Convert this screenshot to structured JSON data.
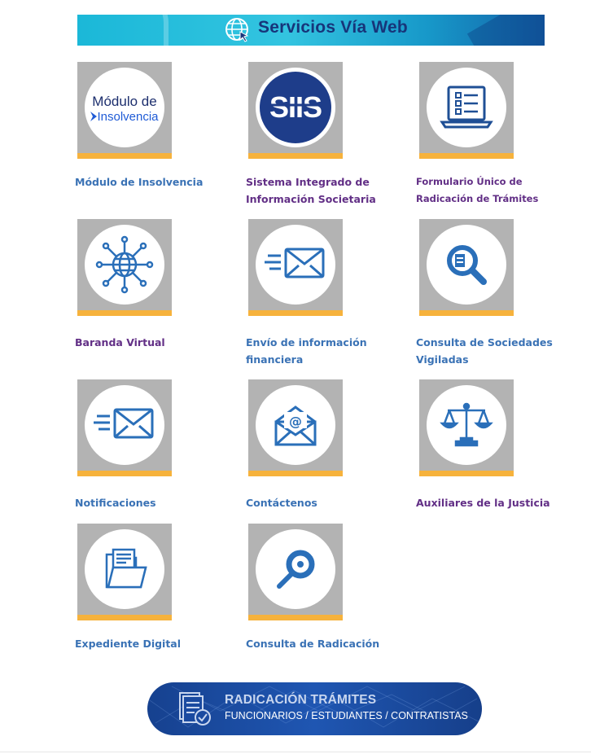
{
  "banner": {
    "title": "Servicios Vía Web",
    "icon": "globe-cursor-icon"
  },
  "services": [
    {
      "label": "Módulo de Insolvencia",
      "icon": "modulo-insolvencia-logo",
      "color": "#3a72b5",
      "logo_line1": "Módulo de",
      "logo_line2": "Insolvencia"
    },
    {
      "label": "Sistema Integrado de Información Societaria",
      "icon": "siis-logo",
      "color": "#622f86",
      "logo_text": "SIIS"
    },
    {
      "label": "Formulario Único de Radicación de Trámites",
      "icon": "laptop-checklist-icon",
      "color": "#622f86"
    },
    {
      "label": "Baranda Virtual",
      "icon": "network-globe-icon",
      "color": "#622f86"
    },
    {
      "label": "Envío de información financiera",
      "icon": "fast-mail-icon",
      "color": "#3a72b5"
    },
    {
      "label": "Consulta de Sociedades Vigiladas",
      "icon": "search-document-icon",
      "color": "#3a72b5"
    },
    {
      "label": "Notificaciones",
      "icon": "fast-mail-icon",
      "color": "#3a72b5"
    },
    {
      "label": "Contáctenos",
      "icon": "email-at-icon",
      "color": "#3a72b5"
    },
    {
      "label": "Auxiliares de la Justicia",
      "icon": "scales-justice-icon",
      "color": "#622f86"
    },
    {
      "label": "Expediente Digital",
      "icon": "folder-documents-icon",
      "color": "#3a72b5"
    },
    {
      "label": "Consulta de Radicación",
      "icon": "magnifier-icon",
      "color": "#3a72b5"
    }
  ],
  "footer_banner": {
    "title": "RADICACIÓN TRÁMITES",
    "subtitle": "FUNCIONARIOS / ESTUDIANTES / CONTRATISTAS",
    "icon": "document-check-icon"
  },
  "colors": {
    "tile_gray": "#b3b3b3",
    "tile_bar": "#f6b23c",
    "icon_blue": "#2a6fb9",
    "banner_title": "#17357a"
  }
}
